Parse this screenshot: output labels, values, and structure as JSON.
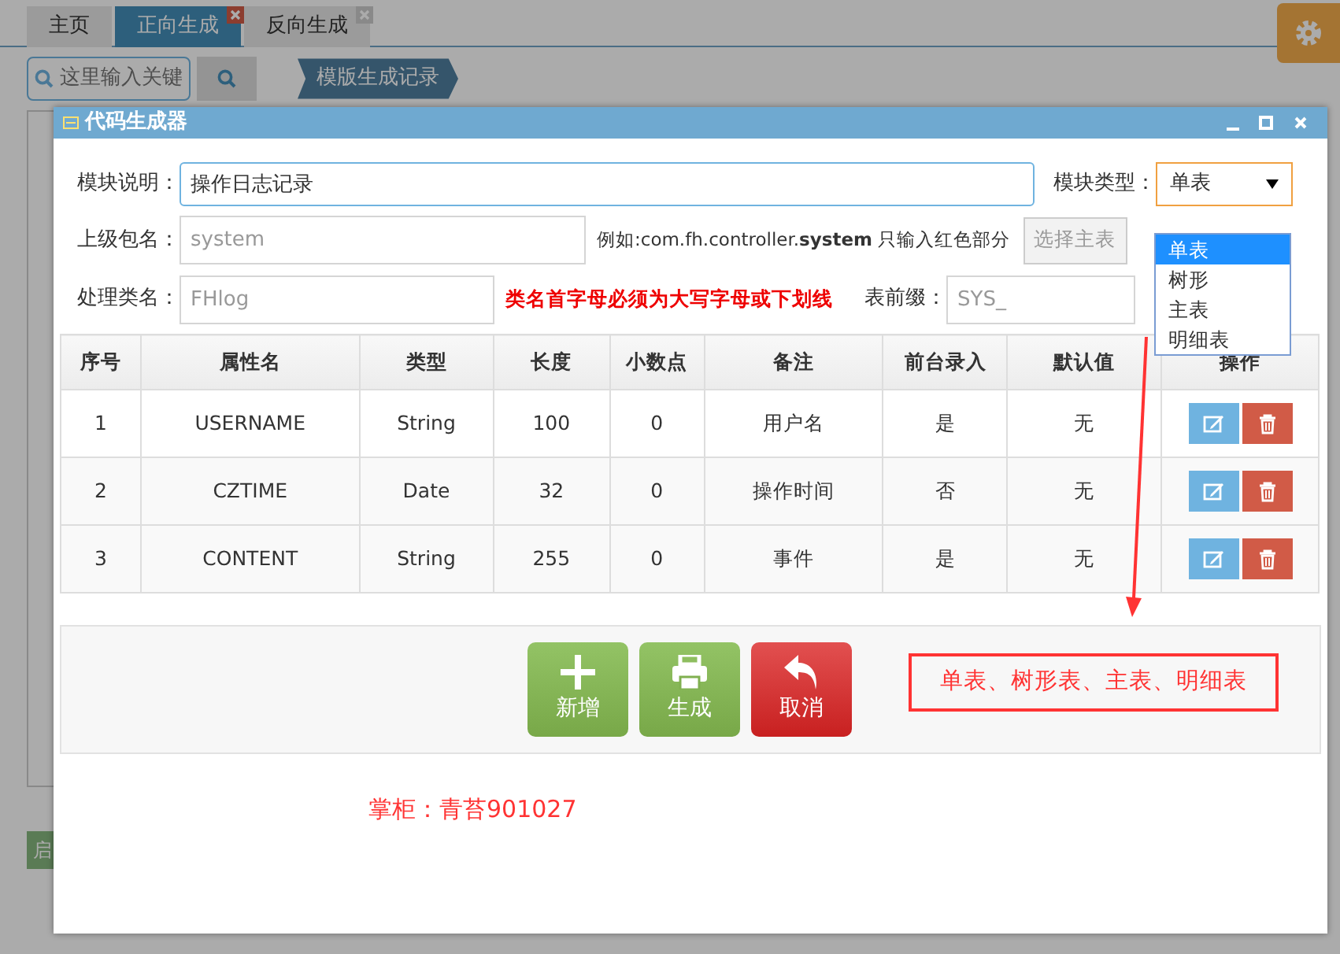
{
  "tabs": [
    {
      "label": "主页",
      "selected": false,
      "closable": false
    },
    {
      "label": "正向生成",
      "selected": true,
      "closable": true
    },
    {
      "label": "反向生成",
      "selected": false,
      "closable": true
    }
  ],
  "search": {
    "placeholder": "这里输入关键"
  },
  "breadcrumb": "模版生成记录",
  "side_button": "启",
  "dialog": {
    "title": "代码生成器",
    "module_desc": {
      "label": "模块说明：",
      "value": "操作日志记录"
    },
    "module_type": {
      "label": "模块类型：",
      "value": "单表",
      "expanded": true,
      "options": [
        {
          "label": "单表",
          "selected": true
        },
        {
          "label": "树形",
          "selected": false
        },
        {
          "label": "主表",
          "selected": false
        },
        {
          "label": "明细表",
          "selected": false
        }
      ]
    },
    "package": {
      "label": "上级包名：",
      "placeholder": "system",
      "hint": "例如:com.fh.controller.**system** 只输入红色部分"
    },
    "pick_main_table": {
      "label": "选择主表",
      "disabled": true
    },
    "class_name": {
      "label": "处理类名：",
      "placeholder": "FHlog",
      "warning": "类名首字母必须为大写字母或下划线"
    },
    "prefix": {
      "label": "表前缀：",
      "placeholder": "SYS_"
    },
    "table": {
      "columns": [
        "序号",
        "属性名",
        "类型",
        "长度",
        "小数点",
        "备注",
        "前台录入",
        "默认值",
        "操作"
      ],
      "rows": [
        [
          "1",
          "USERNAME",
          "String",
          "100",
          "0",
          "用户名",
          "是",
          "无"
        ],
        [
          "2",
          "CZTIME",
          "Date",
          "32",
          "0",
          "操作时间",
          "否",
          "无"
        ],
        [
          "3",
          "CONTENT",
          "String",
          "255",
          "0",
          "事件",
          "是",
          "无"
        ]
      ]
    },
    "buttons": [
      {
        "kind": "add",
        "label": "新增"
      },
      {
        "kind": "print",
        "label": "生成"
      },
      {
        "kind": "cancel",
        "label": "取消"
      }
    ],
    "annotation": "单表、树形表、主表、明细表",
    "signature": "掌柜：青苔901027"
  }
}
